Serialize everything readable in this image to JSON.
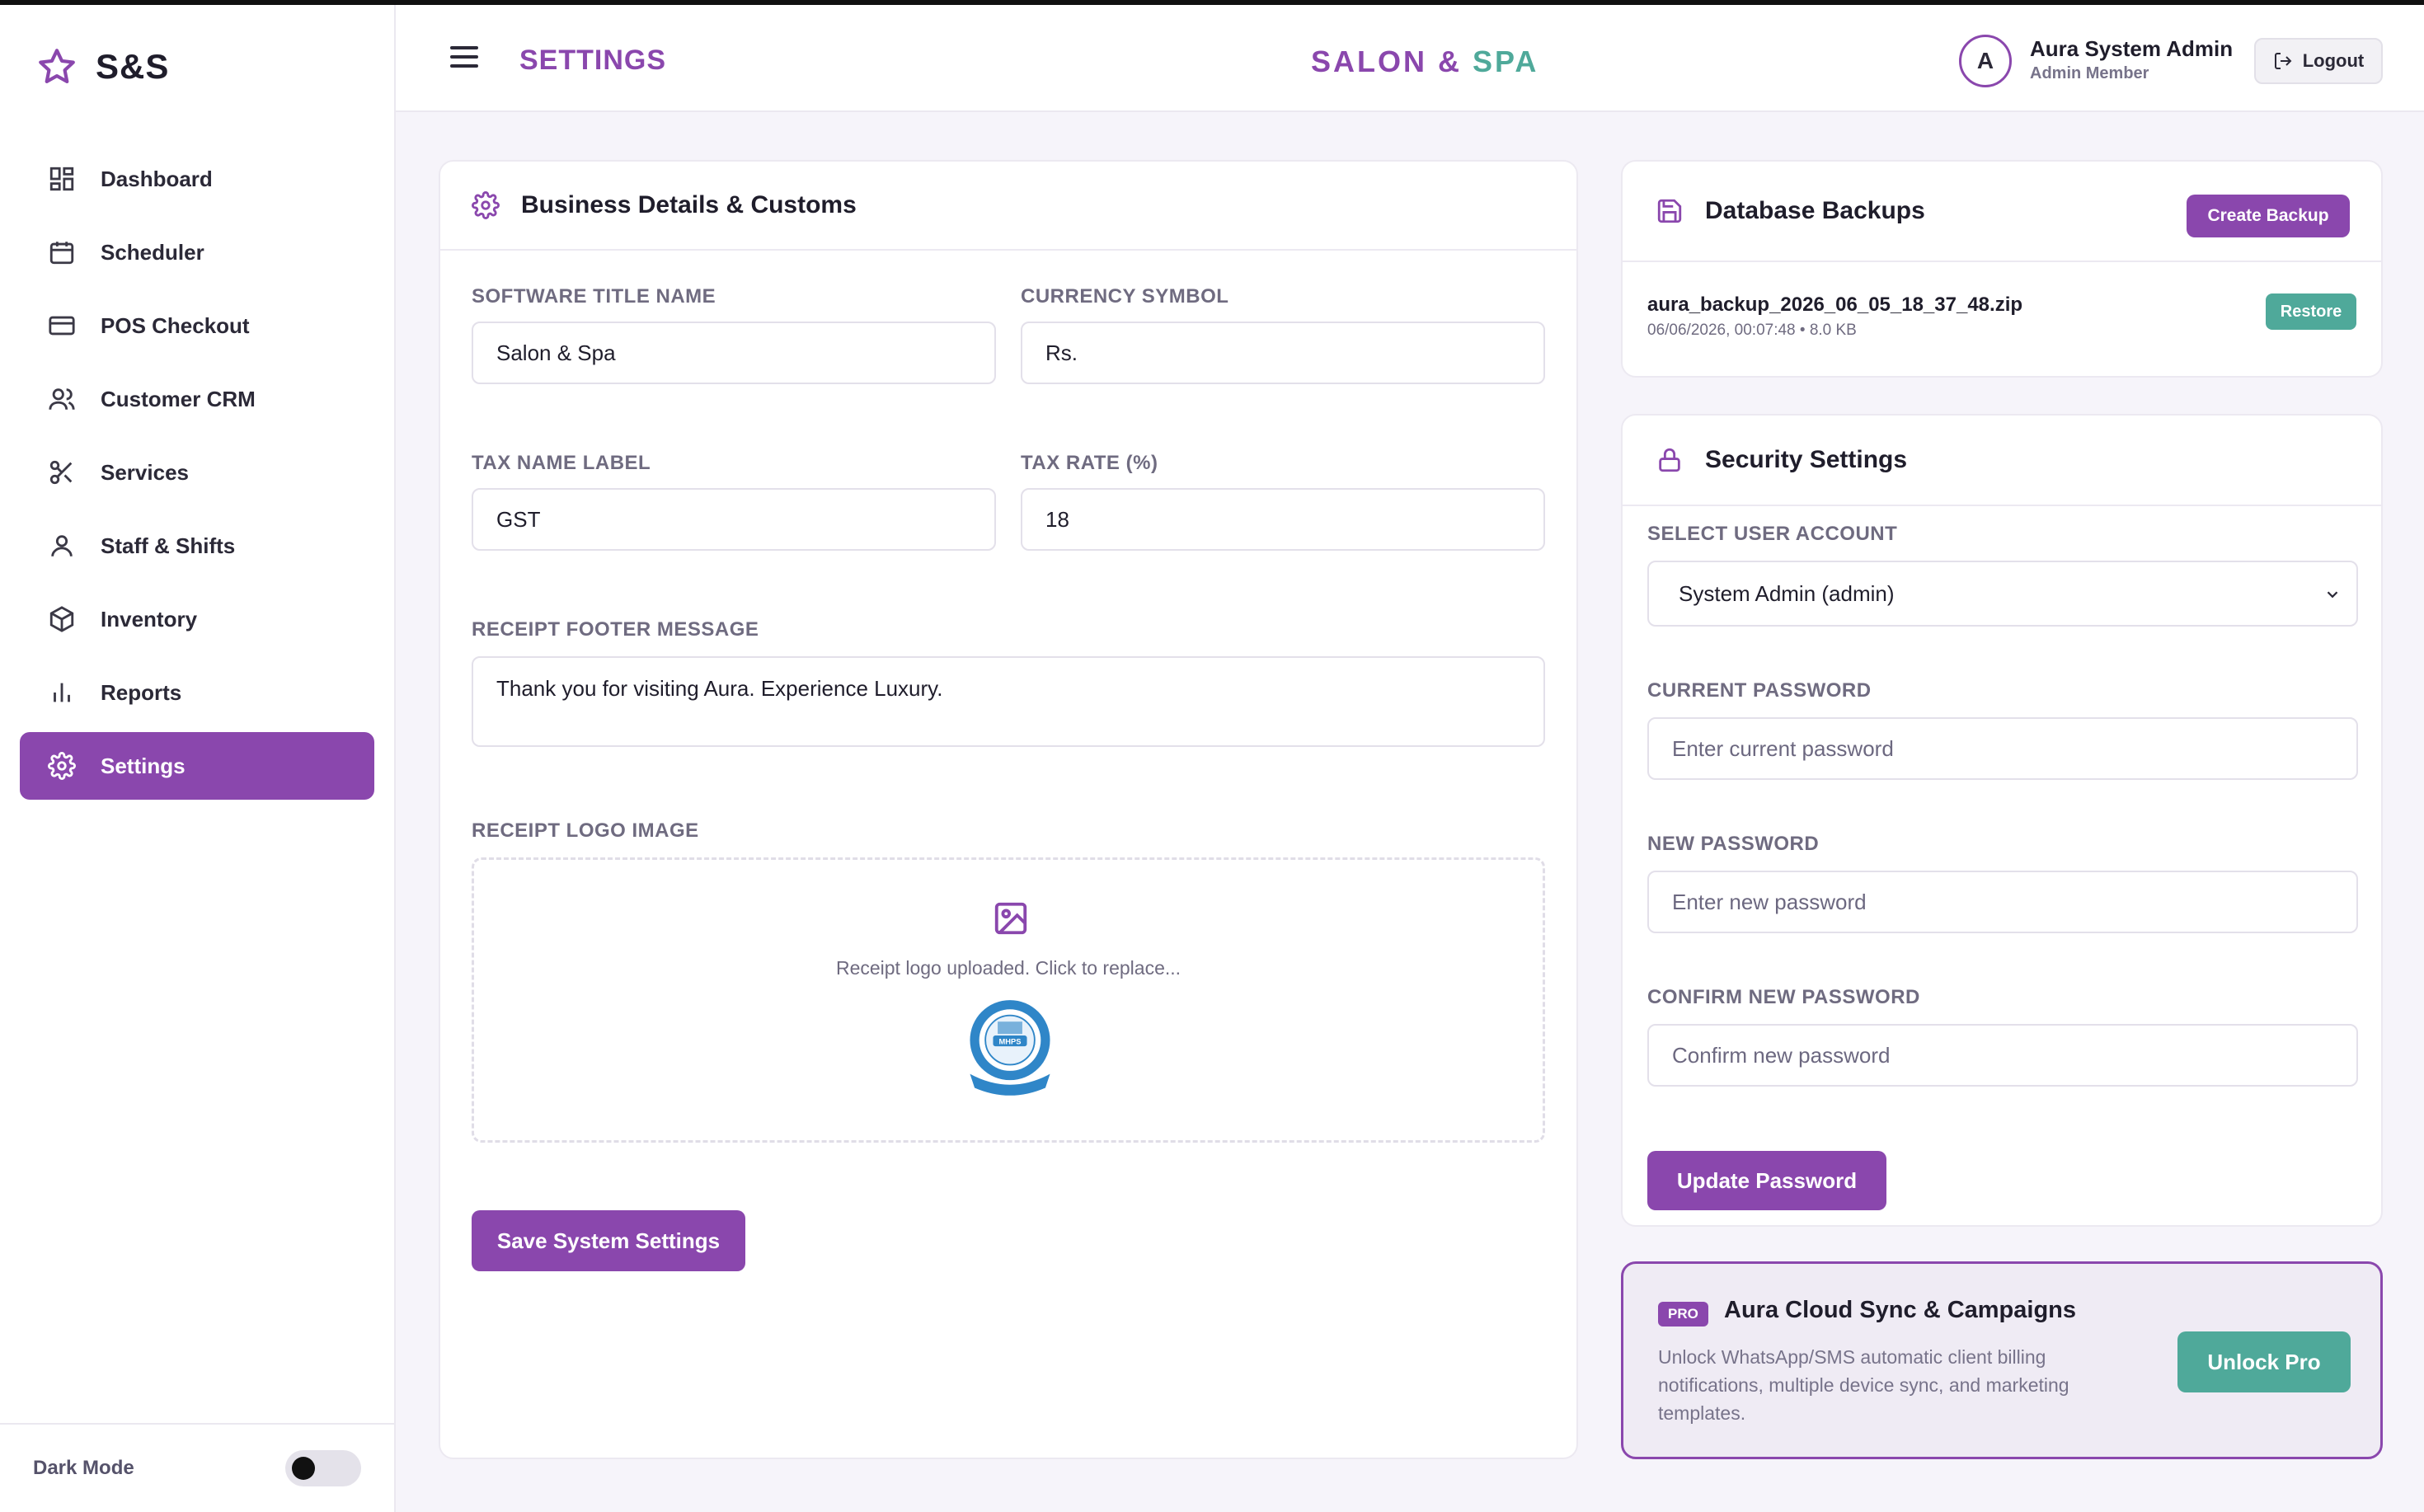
{
  "sidebar": {
    "brand": "S&S",
    "items": [
      {
        "label": "Dashboard",
        "icon": "dashboard-icon"
      },
      {
        "label": "Scheduler",
        "icon": "calendar-icon"
      },
      {
        "label": "POS Checkout",
        "icon": "credit-card-icon"
      },
      {
        "label": "Customer CRM",
        "icon": "users-icon"
      },
      {
        "label": "Services",
        "icon": "scissors-icon"
      },
      {
        "label": "Staff & Shifts",
        "icon": "user-icon"
      },
      {
        "label": "Inventory",
        "icon": "box-icon"
      },
      {
        "label": "Reports",
        "icon": "bar-chart-icon"
      },
      {
        "label": "Settings",
        "icon": "gear-icon"
      }
    ],
    "active_item": "Settings",
    "dark_mode_label": "Dark Mode",
    "dark_mode_on": false
  },
  "header": {
    "page_title": "SETTINGS",
    "center_brand_1": "SALON",
    "center_brand_amp": "&",
    "center_brand_2": "SPA",
    "avatar_letter": "A",
    "user_name": "Aura System Admin",
    "user_role": "Admin Member",
    "logout_label": "Logout"
  },
  "business": {
    "title": "Business Details & Customs",
    "software_title_label": "SOFTWARE TITLE NAME",
    "software_title_value": "Salon & Spa",
    "currency_label": "CURRENCY SYMBOL",
    "currency_value": "Rs.",
    "tax_name_label": "TAX NAME LABEL",
    "tax_name_value": "GST",
    "tax_rate_label": "TAX RATE (%)",
    "tax_rate_value": "18",
    "footer_label": "RECEIPT FOOTER MESSAGE",
    "footer_value": "Thank you for visiting Aura. Experience Luxury.",
    "logo_label": "RECEIPT LOGO IMAGE",
    "logo_hint": "Receipt logo uploaded. Click to replace...",
    "logo_text": "MHPS",
    "save_label": "Save System Settings"
  },
  "backups": {
    "title": "Database Backups",
    "create_label": "Create Backup",
    "files": [
      {
        "name": "aura_backup_2026_06_05_18_37_48.zip",
        "meta": "06/06/2026, 00:07:48 • 8.0 KB",
        "action": "Restore"
      }
    ]
  },
  "security": {
    "title": "Security Settings",
    "select_label": "SELECT USER ACCOUNT",
    "select_value": "System Admin (admin)",
    "current_label": "CURRENT PASSWORD",
    "current_placeholder": "Enter current password",
    "new_label": "NEW PASSWORD",
    "new_placeholder": "Enter new password",
    "confirm_label": "CONFIRM NEW PASSWORD",
    "confirm_placeholder": "Confirm new password",
    "update_label": "Update Password"
  },
  "pro": {
    "badge": "PRO",
    "title": "Aura Cloud Sync & Campaigns",
    "description": "Unlock WhatsApp/SMS automatic client billing notifications, multiple device sync, and marketing templates.",
    "unlock_label": "Unlock Pro"
  },
  "colors": {
    "accent": "#8a47ad",
    "teal": "#4fa99a",
    "background": "#f6f4fa"
  }
}
